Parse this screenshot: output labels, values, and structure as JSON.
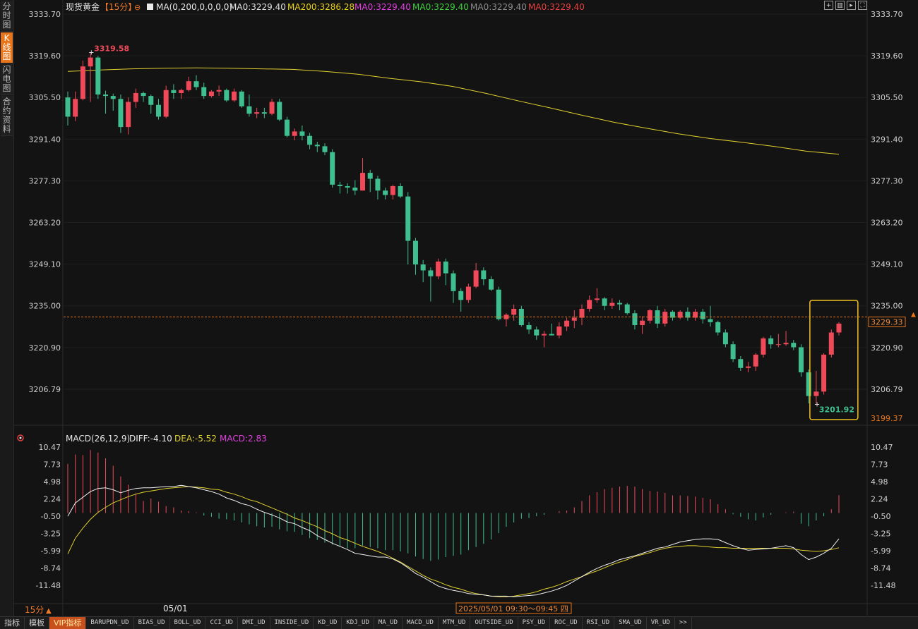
{
  "sidebar": {
    "tabs": [
      {
        "label": "分时图",
        "active": false
      },
      {
        "label": "K线图",
        "active": true
      },
      {
        "label": "闪电图",
        "active": false
      },
      {
        "label": "合约资料",
        "active": false
      }
    ]
  },
  "header": {
    "symbol": "现货黄金",
    "period": "【15分】",
    "ma_params": "MA(0,200,0,0,0,0)",
    "ma_values": [
      {
        "text": "MA0:3229.40",
        "color": "#e0e0e0"
      },
      {
        "text": "MA200:3286.28",
        "color": "#e8d01c"
      },
      {
        "text": "MA0:3229.40",
        "color": "#e040e0"
      },
      {
        "text": "MA0:3229.40",
        "color": "#3fcf3f"
      },
      {
        "text": "MA0:3229.40",
        "color": "#8c8c8c"
      },
      {
        "text": "MA0:3229.40",
        "color": "#e84040"
      }
    ]
  },
  "toolbar_icons": [
    "add-icon",
    "layout-icon",
    "play-icon",
    "fullscreen-icon"
  ],
  "price_axis": {
    "ticks": [
      "3333.70",
      "3319.60",
      "3305.50",
      "3291.40",
      "3277.30",
      "3263.20",
      "3249.10",
      "3235.00",
      "3220.90",
      "3206.79"
    ],
    "current_price": "3229.33",
    "bottom_label": "3199.37"
  },
  "annotations": {
    "high_label": "3319.58",
    "low_label": "3201.92"
  },
  "macd": {
    "title": "MACD(26,12,9)",
    "diff": "DIFF:-4.10",
    "dea": "DEA:-5.52",
    "macd": "MACD:2.83",
    "ticks": [
      "10.47",
      "7.73",
      "4.98",
      "2.24",
      "-0.50",
      "-3.25",
      "-5.99",
      "-8.74",
      "-11.48"
    ]
  },
  "time_axis": {
    "period_button": "15分",
    "date_label": "05/01",
    "cursor_time": "2025/05/01 09:30～09:45 四"
  },
  "bottom_toolbar": [
    "指标",
    "模板",
    "VIP指标",
    "BARUPDN_UD",
    "BIAS_UD",
    "BOLL_UD",
    "CCI_UD",
    "DMI_UD",
    "INSIDE_UD",
    "KD_UD",
    "KDJ_UD",
    "MA_UD",
    "MACD_UD",
    "MTM_UD",
    "OUTSIDE_UD",
    "PSY_UD",
    "ROC_UD",
    "RSI_UD",
    "SMA_UD",
    "VR_UD",
    ">>"
  ],
  "colors": {
    "up": "#f04a5a",
    "down": "#3fbf8f",
    "ma200": "#e0d030",
    "accent": "#e8751a",
    "highlight_box": "#f0c020"
  },
  "chart_data": {
    "type": "candlestick",
    "period": "15分",
    "ylim": [
      3199.37,
      3333.7
    ],
    "ma200": [
      3314.3,
      3314.8,
      3315.2,
      3315.4,
      3315.5,
      3315.4,
      3315.2,
      3315.0,
      3314.3,
      3313.4,
      3312.0,
      3310.8,
      3309.2,
      3306.9,
      3304.4,
      3302.0,
      3299.5,
      3297.1,
      3295.1,
      3293.2,
      3291.6,
      3290.3,
      3288.9,
      3287.3,
      3286.3
    ],
    "candles": [
      [
        3305.5,
        3299.0,
        3307.5,
        3296.0
      ],
      [
        3299.0,
        3305.0,
        3307.5,
        3297.5
      ],
      [
        3305.0,
        3316.0,
        3318.0,
        3304.5
      ],
      [
        3316.0,
        3319.0,
        3320.5,
        3304.0
      ],
      [
        3319.0,
        3306.5,
        3319.5,
        3305.0
      ],
      [
        3306.5,
        3306.0,
        3307.8,
        3300.0
      ],
      [
        3306.0,
        3305.0,
        3306.8,
        3301.0
      ],
      [
        3305.0,
        3295.5,
        3306.5,
        3293.5
      ],
      [
        3295.5,
        3304.0,
        3305.5,
        3293.0
      ],
      [
        3304.0,
        3307.0,
        3308.5,
        3302.0
      ],
      [
        3307.0,
        3306.0,
        3307.5,
        3304.0
      ],
      [
        3306.0,
        3303.0,
        3306.5,
        3300.0
      ],
      [
        3303.0,
        3299.0,
        3305.0,
        3298.0
      ],
      [
        3299.0,
        3308.0,
        3309.5,
        3298.5
      ],
      [
        3308.0,
        3307.0,
        3310.0,
        3305.0
      ],
      [
        3307.0,
        3308.0,
        3308.5,
        3305.0
      ],
      [
        3308.0,
        3311.0,
        3312.5,
        3307.5
      ],
      [
        3311.0,
        3309.0,
        3313.0,
        3308.0
      ],
      [
        3309.0,
        3306.0,
        3310.5,
        3305.0
      ],
      [
        3306.0,
        3307.5,
        3308.0,
        3305.5
      ],
      [
        3307.5,
        3308.0,
        3309.5,
        3306.0
      ],
      [
        3308.0,
        3304.5,
        3308.5,
        3304.0
      ],
      [
        3304.5,
        3307.5,
        3308.5,
        3304.0
      ],
      [
        3307.5,
        3302.5,
        3308.0,
        3302.0
      ],
      [
        3302.5,
        3300.0,
        3306.5,
        3299.0
      ],
      [
        3300.0,
        3300.5,
        3302.0,
        3298.5
      ],
      [
        3300.5,
        3300.0,
        3302.0,
        3298.5
      ],
      [
        3300.0,
        3304.0,
        3305.0,
        3299.5
      ],
      [
        3304.0,
        3298.0,
        3305.0,
        3297.5
      ],
      [
        3298.0,
        3292.5,
        3299.0,
        3292.0
      ],
      [
        3292.5,
        3294.0,
        3295.0,
        3291.0
      ],
      [
        3294.0,
        3292.5,
        3296.0,
        3291.0
      ],
      [
        3292.5,
        3289.5,
        3293.5,
        3288.0
      ],
      [
        3289.5,
        3289.0,
        3290.5,
        3287.0
      ],
      [
        3289.0,
        3287.0,
        3290.0,
        3286.0
      ],
      [
        3287.0,
        3276.0,
        3288.0,
        3275.0
      ],
      [
        3276.0,
        3275.5,
        3277.0,
        3273.0
      ],
      [
        3275.5,
        3275.0,
        3276.5,
        3273.0
      ],
      [
        3275.0,
        3274.0,
        3277.5,
        3272.5
      ],
      [
        3274.0,
        3280.0,
        3285.0,
        3274.0
      ],
      [
        3280.0,
        3278.0,
        3281.0,
        3273.5
      ],
      [
        3278.0,
        3274.0,
        3279.0,
        3271.0
      ],
      [
        3274.0,
        3272.5,
        3275.0,
        3271.0
      ],
      [
        3272.5,
        3275.5,
        3276.0,
        3271.0
      ],
      [
        3275.5,
        3272.0,
        3276.5,
        3271.5
      ],
      [
        3272.0,
        3257.0,
        3273.5,
        3249.0
      ],
      [
        3257.0,
        3249.0,
        3258.0,
        3245.5
      ],
      [
        3249.0,
        3247.0,
        3250.5,
        3243.0
      ],
      [
        3247.0,
        3245.0,
        3248.0,
        3236.5
      ],
      [
        3245.0,
        3250.0,
        3251.0,
        3244.0
      ],
      [
        3250.0,
        3246.0,
        3251.0,
        3242.0
      ],
      [
        3246.0,
        3240.0,
        3247.0,
        3236.0
      ],
      [
        3240.0,
        3237.0,
        3241.0,
        3233.0
      ],
      [
        3237.0,
        3241.5,
        3242.5,
        3236.0
      ],
      [
        3241.5,
        3247.0,
        3249.5,
        3241.0
      ],
      [
        3247.0,
        3244.0,
        3248.0,
        3242.0
      ],
      [
        3244.0,
        3240.5,
        3245.0,
        3240.0
      ],
      [
        3240.5,
        3230.5,
        3241.5,
        3230.0
      ],
      [
        3230.5,
        3232.0,
        3232.5,
        3228.0
      ],
      [
        3232.0,
        3234.0,
        3235.5,
        3230.0
      ],
      [
        3234.0,
        3228.5,
        3235.0,
        3228.0
      ],
      [
        3228.5,
        3227.0,
        3229.5,
        3225.5
      ],
      [
        3227.0,
        3225.0,
        3228.0,
        3223.5
      ],
      [
        3225.0,
        3225.5,
        3226.5,
        3221.0
      ],
      [
        3225.5,
        3225.0,
        3229.0,
        3225.0
      ],
      [
        3225.0,
        3228.0,
        3229.5,
        3224.0
      ],
      [
        3228.0,
        3230.0,
        3231.0,
        3226.5
      ],
      [
        3230.0,
        3231.0,
        3233.5,
        3227.5
      ],
      [
        3231.0,
        3234.0,
        3235.5,
        3228.5
      ],
      [
        3234.0,
        3237.0,
        3238.5,
        3233.0
      ],
      [
        3237.0,
        3237.5,
        3241.0,
        3236.0
      ],
      [
        3237.5,
        3235.0,
        3238.0,
        3233.5
      ],
      [
        3235.0,
        3236.0,
        3237.5,
        3234.0
      ],
      [
        3236.0,
        3235.5,
        3237.0,
        3233.5
      ],
      [
        3235.5,
        3232.5,
        3236.0,
        3232.0
      ],
      [
        3232.5,
        3228.5,
        3233.5,
        3227.0
      ],
      [
        3228.5,
        3230.0,
        3231.5,
        3225.5
      ],
      [
        3230.0,
        3233.5,
        3234.0,
        3229.0
      ],
      [
        3233.5,
        3229.0,
        3235.0,
        3227.5
      ],
      [
        3229.0,
        3233.0,
        3234.0,
        3228.0
      ],
      [
        3233.0,
        3231.0,
        3233.5,
        3230.0
      ],
      [
        3231.0,
        3233.0,
        3233.5,
        3230.5
      ],
      [
        3233.0,
        3231.0,
        3234.5,
        3230.0
      ],
      [
        3231.0,
        3233.0,
        3234.0,
        3230.0
      ],
      [
        3233.0,
        3230.5,
        3234.0,
        3229.0
      ],
      [
        3230.5,
        3229.5,
        3235.0,
        3228.0
      ],
      [
        3229.5,
        3226.0,
        3230.0,
        3225.0
      ],
      [
        3226.0,
        3222.0,
        3227.0,
        3221.0
      ],
      [
        3222.0,
        3217.0,
        3223.0,
        3216.0
      ],
      [
        3217.0,
        3214.0,
        3218.0,
        3213.0
      ],
      [
        3214.0,
        3214.5,
        3216.0,
        3212.5
      ],
      [
        3214.5,
        3218.5,
        3219.0,
        3213.0
      ],
      [
        3218.5,
        3224.0,
        3224.5,
        3217.5
      ],
      [
        3224.0,
        3222.0,
        3225.0,
        3220.5
      ],
      [
        3222.0,
        3222.0,
        3225.5,
        3221.0
      ],
      [
        3222.0,
        3222.5,
        3226.5,
        3221.5
      ],
      [
        3222.5,
        3221.0,
        3223.5,
        3220.0
      ],
      [
        3221.0,
        3212.5,
        3222.0,
        3211.0
      ],
      [
        3212.5,
        3204.5,
        3213.5,
        3202.0
      ],
      [
        3204.5,
        3206.0,
        3213.0,
        3201.92
      ],
      [
        3206.0,
        3218.5,
        3219.0,
        3205.0
      ],
      [
        3218.5,
        3226.0,
        3227.0,
        3217.5
      ],
      [
        3226.0,
        3229.0,
        3229.5,
        3225.0
      ]
    ],
    "macd_hist": [
      7.8,
      9.3,
      9.2,
      10.0,
      9.6,
      8.7,
      7.5,
      5.8,
      4.5,
      3.1,
      1.9,
      2.3,
      1.8,
      1.1,
      0.9,
      0.4,
      0.3,
      0.1,
      -0.4,
      -0.6,
      -0.9,
      -1.0,
      -1.2,
      -1.5,
      -1.8,
      -2.1,
      -2.3,
      -2.2,
      -2.6,
      -2.9,
      -3.0,
      -3.5,
      -4.0,
      -4.3,
      -4.7,
      -5.0,
      -5.3,
      -5.6,
      -5.6,
      -5.2,
      -5.4,
      -5.6,
      -5.9,
      -5.9,
      -6.1,
      -6.4,
      -6.9,
      -7.3,
      -7.6,
      -7.4,
      -7.0,
      -6.8,
      -6.6,
      -5.9,
      -5.4,
      -4.9,
      -4.2,
      -3.2,
      -2.2,
      -1.5,
      -0.9,
      -0.8,
      -0.5,
      -0.3,
      0.0,
      0.3,
      0.4,
      0.9,
      1.9,
      2.8,
      3.3,
      3.8,
      4.0,
      4.2,
      4.3,
      4.2,
      3.8,
      3.5,
      3.4,
      3.2,
      2.8,
      2.8,
      2.7,
      2.6,
      2.4,
      2.2,
      1.4,
      0.6,
      -0.2,
      -0.6,
      -1.0,
      -1.2,
      -0.7,
      -0.3,
      0.0,
      0.1,
      0.2,
      -1.7,
      -2.1,
      -1.2,
      -0.5,
      0.6,
      2.83
    ],
    "macd_diff": [
      -0.5,
      1.6,
      2.5,
      3.4,
      3.9,
      4.0,
      3.7,
      3.2,
      3.6,
      3.9,
      4.0,
      4.0,
      4.1,
      4.2,
      4.2,
      4.4,
      4.2,
      4.0,
      3.7,
      3.4,
      3.0,
      2.4,
      2.0,
      1.5,
      1.2,
      0.6,
      0.1,
      -0.3,
      -0.8,
      -1.4,
      -1.7,
      -2.3,
      -2.8,
      -3.6,
      -4.2,
      -4.8,
      -5.3,
      -5.8,
      -6.4,
      -6.6,
      -6.8,
      -7.0,
      -7.0,
      -7.3,
      -7.9,
      -8.7,
      -9.6,
      -10.2,
      -10.9,
      -11.6,
      -12.0,
      -12.3,
      -12.5,
      -12.8,
      -12.9,
      -13.0,
      -13.2,
      -13.2,
      -13.2,
      -13.3,
      -13.2,
      -13.1,
      -13.0,
      -12.7,
      -12.4,
      -12.0,
      -11.5,
      -10.8,
      -10.1,
      -9.4,
      -8.8,
      -8.3,
      -7.9,
      -7.4,
      -7.1,
      -6.8,
      -6.4,
      -6.0,
      -5.6,
      -5.4,
      -5.0,
      -4.6,
      -4.4,
      -4.2,
      -4.1,
      -4.1,
      -4.2,
      -4.7,
      -5.2,
      -5.6,
      -5.9,
      -5.8,
      -5.7,
      -5.6,
      -5.4,
      -5.2,
      -5.5,
      -6.6,
      -7.4,
      -7.0,
      -6.4,
      -5.6,
      -4.1
    ],
    "macd_dea": [
      -6.5,
      -4.0,
      -2.4,
      -1.0,
      0.1,
      0.9,
      1.6,
      2.1,
      2.6,
      3.0,
      3.3,
      3.5,
      3.7,
      3.9,
      4.0,
      4.1,
      4.2,
      4.1,
      4.0,
      3.8,
      3.7,
      3.3,
      3.0,
      2.6,
      2.1,
      1.8,
      1.3,
      0.8,
      0.3,
      -0.2,
      -0.8,
      -1.2,
      -1.7,
      -2.2,
      -2.8,
      -3.3,
      -3.9,
      -4.3,
      -4.8,
      -5.3,
      -5.7,
      -6.1,
      -6.6,
      -7.2,
      -7.8,
      -8.5,
      -9.2,
      -9.9,
      -10.5,
      -10.9,
      -11.4,
      -11.8,
      -12.1,
      -12.5,
      -12.8,
      -13.0,
      -13.2,
      -13.3,
      -13.3,
      -13.2,
      -13.0,
      -12.8,
      -12.5,
      -12.1,
      -11.8,
      -11.4,
      -10.9,
      -10.5,
      -10.1,
      -9.6,
      -9.2,
      -8.7,
      -8.2,
      -7.8,
      -7.4,
      -6.9,
      -6.6,
      -6.3,
      -5.9,
      -5.6,
      -5.4,
      -5.3,
      -5.2,
      -5.2,
      -5.3,
      -5.4,
      -5.5,
      -5.5,
      -5.6,
      -5.6,
      -5.6,
      -5.6,
      -5.6,
      -5.6,
      -5.6,
      -5.6,
      -5.7,
      -5.9,
      -6.0,
      -6.1,
      -6.0,
      -5.8,
      -5.52
    ]
  }
}
